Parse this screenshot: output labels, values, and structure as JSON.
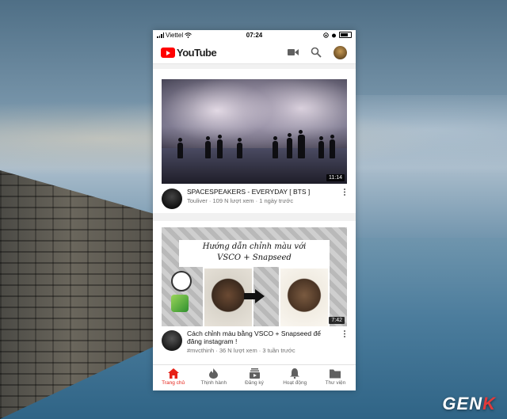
{
  "statusbar": {
    "carrier": "Viettel",
    "time": "07:24"
  },
  "appbar": {
    "logo_text": "YouTube",
    "icons": [
      "video-camera-icon",
      "search-icon",
      "avatar"
    ]
  },
  "videos": [
    {
      "title": "SPACESPEAKERS - EVERYDAY [ BTS ]",
      "channel_line": "Touliver · 109 N lượt xem · 1 ngày trước",
      "duration": "11:14"
    },
    {
      "thumb_text_line1": "Hướng dẫn chỉnh màu với",
      "thumb_text_line2": "VSCO + Snapseed",
      "title": "Cách chỉnh màu bằng VSCO + Snapseed để đăng instagram !",
      "channel_line": "#mvcthinh · 36 N lượt xem · 3 tuần trước",
      "duration": "7:42"
    }
  ],
  "tabs": [
    {
      "label": "Trang chủ",
      "icon": "home-icon"
    },
    {
      "label": "Thịnh hành",
      "icon": "flame-icon"
    },
    {
      "label": "Đăng ký",
      "icon": "subscriptions-icon"
    },
    {
      "label": "Hoạt động",
      "icon": "bell-icon"
    },
    {
      "label": "Thư viện",
      "icon": "folder-icon"
    }
  ],
  "watermark": {
    "text_main": "GEN",
    "text_accent": "K"
  },
  "colors": {
    "youtube_red": "#ff0000",
    "active_tab": "#e62117",
    "annotation_arrow": "#e0312d"
  }
}
